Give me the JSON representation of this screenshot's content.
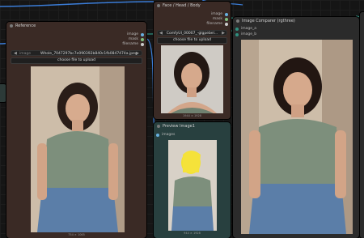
{
  "reference": {
    "title": "Reference",
    "outputs": [
      "image",
      "mask",
      "filename"
    ],
    "image_widget_label": "image",
    "image_widget_value": "Whole_7047297bc7e090392b840c1fb0847474a.jpeg",
    "upload_label": "choose file to upload",
    "image_size": "754 × 1065"
  },
  "face_head_body": {
    "title": "Face / Head / Body",
    "outputs": [
      "image",
      "mask",
      "filename"
    ],
    "image_widget_value": "ComfyUI_00007_-glgpebel...",
    "upload_label": "choose file to upload",
    "image_size": "1944 × 1928"
  },
  "preview": {
    "title": "Preview Image1",
    "input": "images",
    "image_size": "944 × 1928"
  },
  "comparer": {
    "title": "Image Comparer (rgthree)",
    "inputs": [
      "image_a",
      "image_b"
    ]
  },
  "colors": {
    "reference_bg": "#3a2a25",
    "face_bg": "#3a2a25",
    "preview_bg": "#28403f",
    "comparer_bg": "#2b2b2b",
    "link_blue": "#3b7dd8"
  }
}
